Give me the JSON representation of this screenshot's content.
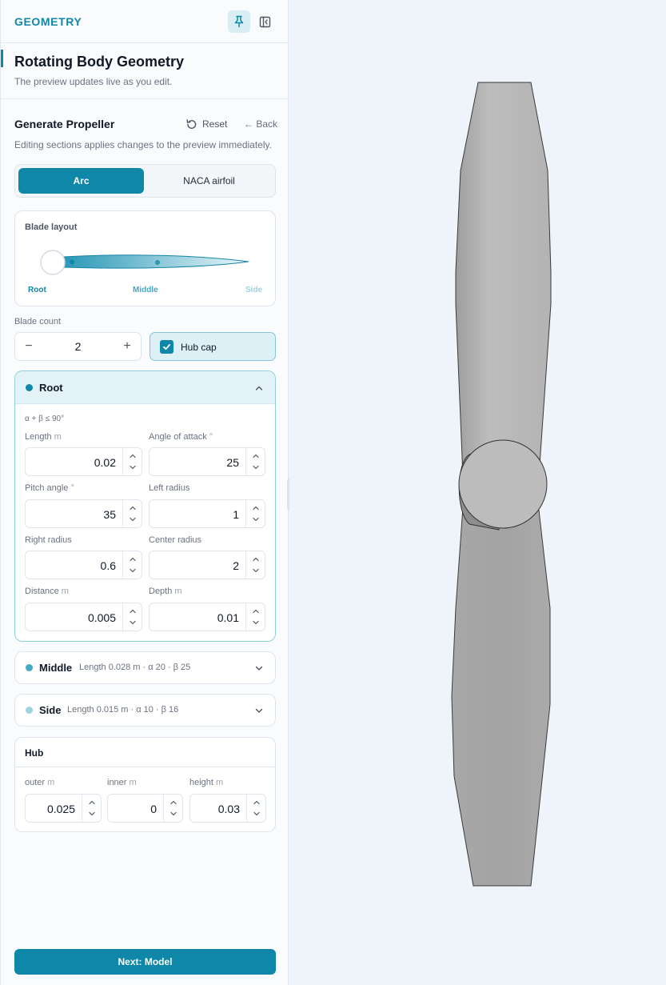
{
  "header": {
    "brand": "GEOMETRY",
    "pin_icon": "pin-icon",
    "collapse_icon": "sidebar-collapse-icon"
  },
  "title_block": {
    "title": "Rotating Body Geometry",
    "subtitle": "The preview updates live as you edit."
  },
  "generator": {
    "title": "Generate Propeller",
    "reset_label": "Reset",
    "back_label": "← Back",
    "description": "Editing sections applies changes to the preview immediately."
  },
  "profile_tabs": {
    "active": "Arc",
    "inactive": "NACA airfoil"
  },
  "blade_layout": {
    "title": "Blade layout",
    "labels": {
      "root": "Root",
      "middle": "Middle",
      "side": "Side"
    }
  },
  "blade_count": {
    "label": "Blade count",
    "value": "2",
    "minus": "−",
    "plus": "+"
  },
  "hub_cap": {
    "label": "Hub cap",
    "checked": true
  },
  "root": {
    "name": "Root",
    "constraint": "α + β ≤ 90°",
    "fields": {
      "length": {
        "label": "Length",
        "unit": "m",
        "value": "0.02"
      },
      "angle_of_attack": {
        "label": "Angle of attack",
        "unit": "°",
        "value": "25"
      },
      "pitch_angle": {
        "label": "Pitch angle",
        "unit": "°",
        "value": "35"
      },
      "left_radius": {
        "label": "Left radius",
        "unit": "",
        "value": "1"
      },
      "right_radius": {
        "label": "Right radius",
        "unit": "",
        "value": "0.6"
      },
      "center_radius": {
        "label": "Center radius",
        "unit": "",
        "value": "2"
      },
      "distance": {
        "label": "Distance",
        "unit": "m",
        "value": "0.005"
      },
      "depth": {
        "label": "Depth",
        "unit": "m",
        "value": "0.01"
      }
    }
  },
  "middle": {
    "name": "Middle",
    "summary": "Length 0.028 m · α 20 · β 25"
  },
  "side": {
    "name": "Side",
    "summary": "Length 0.015 m · α 10 · β 16"
  },
  "hub": {
    "title": "Hub",
    "outer": {
      "label": "outer",
      "unit": "m",
      "value": "0.025"
    },
    "inner": {
      "label": "inner",
      "unit": "m",
      "value": "0"
    },
    "height": {
      "label": "height",
      "unit": "m",
      "value": "0.03"
    }
  },
  "next_button": "Next: Model",
  "colors": {
    "accent": "#0f87a8",
    "middle_dot": "#46a9c2",
    "side_dot": "#9fd3e2",
    "blade": "#b9b9b9",
    "viewport_bg": "#eff3fa"
  }
}
